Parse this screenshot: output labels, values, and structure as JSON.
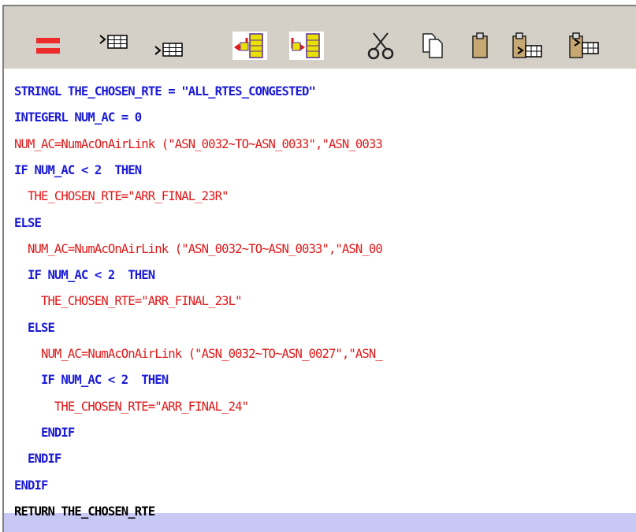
{
  "toolbar": {
    "buttons": [
      {
        "icon": "equals-icon",
        "name": "equals"
      },
      {
        "icon": "insert-row-above-icon",
        "name": "insert-above"
      },
      {
        "icon": "insert-row-below-icon",
        "name": "insert-below"
      },
      {
        "icon": "move-left-icon",
        "name": "move-left"
      },
      {
        "icon": "move-right-icon",
        "name": "move-right"
      },
      {
        "icon": "cut-icon",
        "name": "cut"
      },
      {
        "icon": "copy-icon",
        "name": "copy"
      },
      {
        "icon": "paste-icon",
        "name": "paste"
      },
      {
        "icon": "paste-above-icon",
        "name": "paste-above"
      },
      {
        "icon": "paste-below-icon",
        "name": "paste-below"
      }
    ]
  },
  "colors": {
    "keyword": "#1b1bd6",
    "string": "#e01818",
    "selection": "#c8c8f4",
    "toolbar": "#d4d0c8"
  },
  "code": {
    "lines": [
      {
        "text": "STRINGL THE_CHOSEN_RTE = \"ALL_RTES_CONGESTED\"",
        "style": "kw"
      },
      {
        "text": "INTEGERL NUM_AC = 0",
        "style": "kw"
      },
      {
        "text": "NUM_AC=NumAcOnAirLink (\"ASN_0032~TO~ASN_0033\",\"ASN_0033",
        "style": "str"
      },
      {
        "text": "IF NUM_AC < 2  THEN",
        "style": "kw"
      },
      {
        "text": "  THE_CHOSEN_RTE=\"ARR_FINAL_23R\"",
        "style": "str"
      },
      {
        "text": "ELSE",
        "style": "kw"
      },
      {
        "text": "  NUM_AC=NumAcOnAirLink (\"ASN_0032~TO~ASN_0033\",\"ASN_00",
        "style": "str"
      },
      {
        "text": "  IF NUM_AC < 2  THEN",
        "style": "kw"
      },
      {
        "text": "    THE_CHOSEN_RTE=\"ARR_FINAL_23L\"",
        "style": "str"
      },
      {
        "text": "  ELSE",
        "style": "kw"
      },
      {
        "text": "    NUM_AC=NumAcOnAirLink (\"ASN_0032~TO~ASN_0027\",\"ASN_",
        "style": "str"
      },
      {
        "text": "    IF NUM_AC < 2  THEN",
        "style": "kw"
      },
      {
        "text": "      THE_CHOSEN_RTE=\"ARR_FINAL_24\"",
        "style": "str"
      },
      {
        "text": "    ENDIF",
        "style": "kw"
      },
      {
        "text": "  ENDIF",
        "style": "kw"
      },
      {
        "text": "ENDIF",
        "style": "kw"
      },
      {
        "text": "RETURN THE_CHOSEN_RTE",
        "style": "plain"
      }
    ],
    "selected_line": 16
  }
}
